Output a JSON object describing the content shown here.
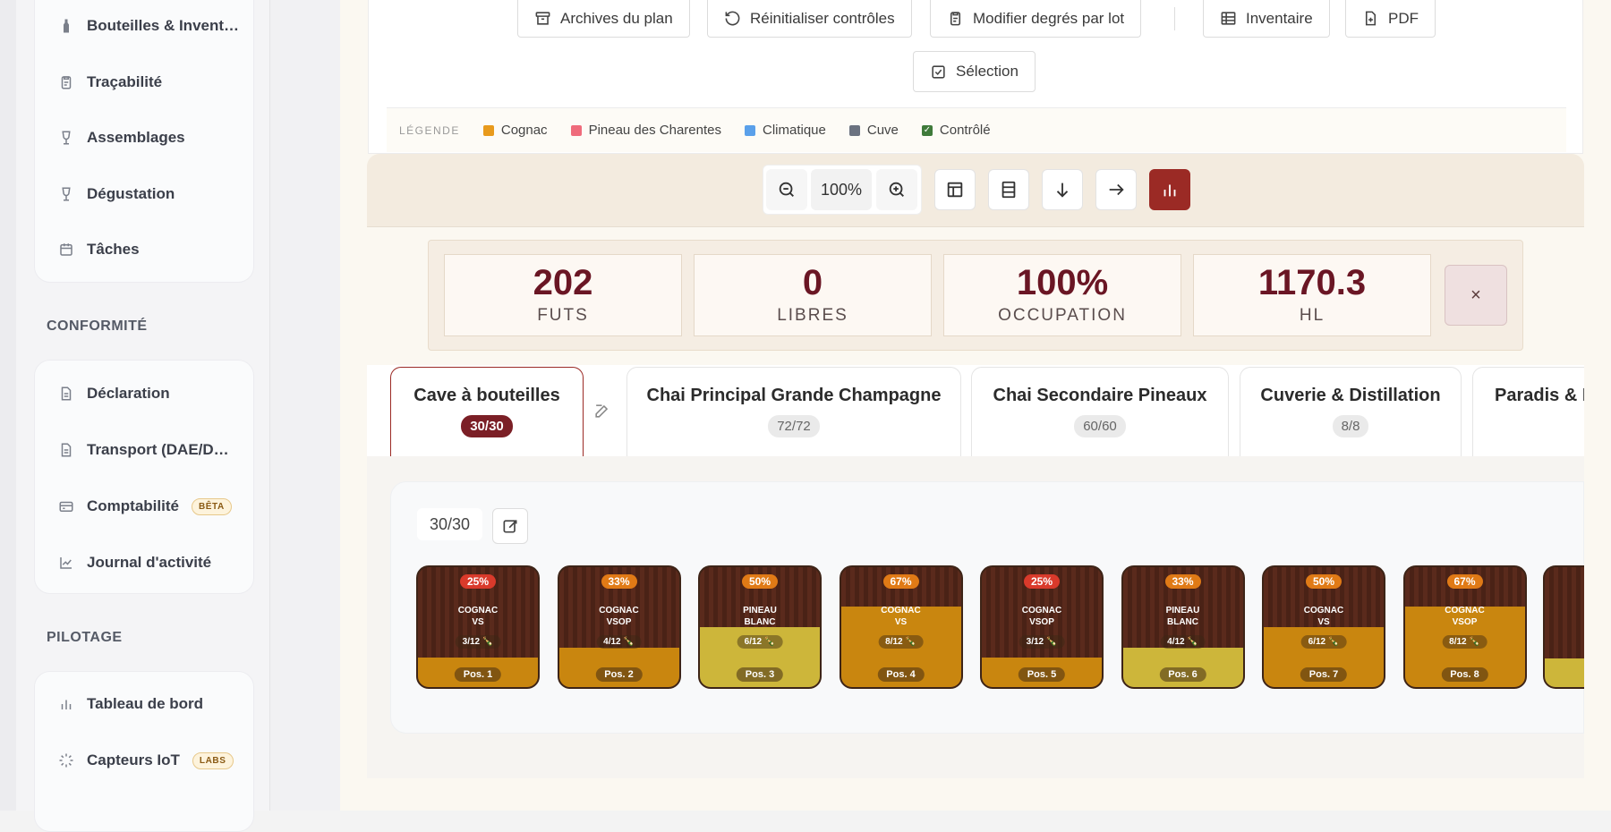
{
  "sidebar": {
    "top_items": [
      {
        "label": "Bouteilles & Invent…",
        "icon": "bottle-icon"
      },
      {
        "label": "Traçabilité",
        "icon": "clipboard-icon"
      },
      {
        "label": "Assemblages",
        "icon": "wine-glass-icon"
      },
      {
        "label": "Dégustation",
        "icon": "wine-glass-icon"
      },
      {
        "label": "Tâches",
        "icon": "calendar-icon"
      }
    ],
    "section_conformite": "CONFORMITÉ",
    "conformite_items": [
      {
        "label": "Déclaration",
        "icon": "document-icon"
      },
      {
        "label": "Transport (DAE/D…",
        "icon": "document-icon"
      },
      {
        "label": "Comptabilité",
        "icon": "credit-card-icon",
        "badge": "BÊTA"
      },
      {
        "label": "Journal d'activité",
        "icon": "line-chart-icon"
      }
    ],
    "section_pilotage": "PILOTAGE",
    "pilotage_items": [
      {
        "label": "Tableau de bord",
        "icon": "bar-chart-icon"
      },
      {
        "label": "Capteurs IoT",
        "icon": "loader-icon",
        "badge": "LABS"
      }
    ]
  },
  "actions": {
    "archives": "Archives du plan",
    "reset": "Réinitialiser contrôles",
    "degrees": "Modifier degrés par lot",
    "inventory": "Inventaire",
    "pdf": "PDF",
    "selection": "Sélection"
  },
  "legend": {
    "title": "LÉGENDE",
    "items": [
      {
        "label": "Cognac",
        "color": "#e89a1c"
      },
      {
        "label": "Pineau des Charentes",
        "color": "#ef6b7b"
      },
      {
        "label": "Climatique",
        "color": "#5aa0ea"
      },
      {
        "label": "Cuve",
        "color": "#6b7280"
      },
      {
        "label": "Contrôlé",
        "color": "#3f7a3a"
      }
    ]
  },
  "zoom": {
    "value": "100%"
  },
  "stats": [
    {
      "value": "202",
      "label": "FUTS"
    },
    {
      "value": "0",
      "label": "LIBRES"
    },
    {
      "value": "100%",
      "label": "OCCUPATION"
    },
    {
      "value": "1170.3",
      "label": "HL"
    }
  ],
  "close_label": "×",
  "tabs": [
    {
      "name": "Cave à bouteilles",
      "count": "30/30"
    },
    {
      "name": "Chai Principal Grande Champagne",
      "count": "72/72"
    },
    {
      "name": "Chai Secondaire Pineaux",
      "count": "60/60"
    },
    {
      "name": "Cuverie & Distillation",
      "count": "8/8"
    },
    {
      "name": "Paradis & R",
      "count": ""
    }
  ],
  "grid": {
    "count": "30/30"
  },
  "barrels": [
    {
      "pct": "25%",
      "level": 0.25,
      "name": "COGNAC\nVS",
      "qty": "3/12 🍾",
      "pos": "Pos. 1",
      "type": "cognac",
      "badge": "#d93a2b"
    },
    {
      "pct": "33%",
      "level": 0.33,
      "name": "COGNAC\nVSOP",
      "qty": "4/12 🍾",
      "pos": "Pos. 2",
      "type": "cognac",
      "badge": "#e07a16"
    },
    {
      "pct": "50%",
      "level": 0.5,
      "name": "PINEAU\nBLANC",
      "qty": "6/12 🍾",
      "pos": "Pos. 3",
      "type": "pineau",
      "badge": "#e07a16"
    },
    {
      "pct": "67%",
      "level": 0.67,
      "name": "COGNAC\nVS",
      "qty": "8/12 🍾",
      "pos": "Pos. 4",
      "type": "cognac",
      "badge": "#e07a16"
    },
    {
      "pct": "25%",
      "level": 0.25,
      "name": "COGNAC\nVSOP",
      "qty": "3/12 🍾",
      "pos": "Pos. 5",
      "type": "cognac",
      "badge": "#d93a2b"
    },
    {
      "pct": "33%",
      "level": 0.33,
      "name": "PINEAU\nBLANC",
      "qty": "4/12 🍾",
      "pos": "Pos. 6",
      "type": "pineau",
      "badge": "#e07a16"
    },
    {
      "pct": "50%",
      "level": 0.5,
      "name": "COGNAC\nVS",
      "qty": "6/12 🍾",
      "pos": "Pos. 7",
      "type": "cognac",
      "badge": "#e07a16"
    },
    {
      "pct": "67%",
      "level": 0.67,
      "name": "COGNAC\nVSOP",
      "qty": "8/12 🍾",
      "pos": "Pos. 8",
      "type": "cognac",
      "badge": "#e07a16"
    }
  ],
  "colors": {
    "cognac_fill": "#c9860f",
    "pineau_fill": "#cdb63a",
    "accent": "#9b2a25"
  }
}
